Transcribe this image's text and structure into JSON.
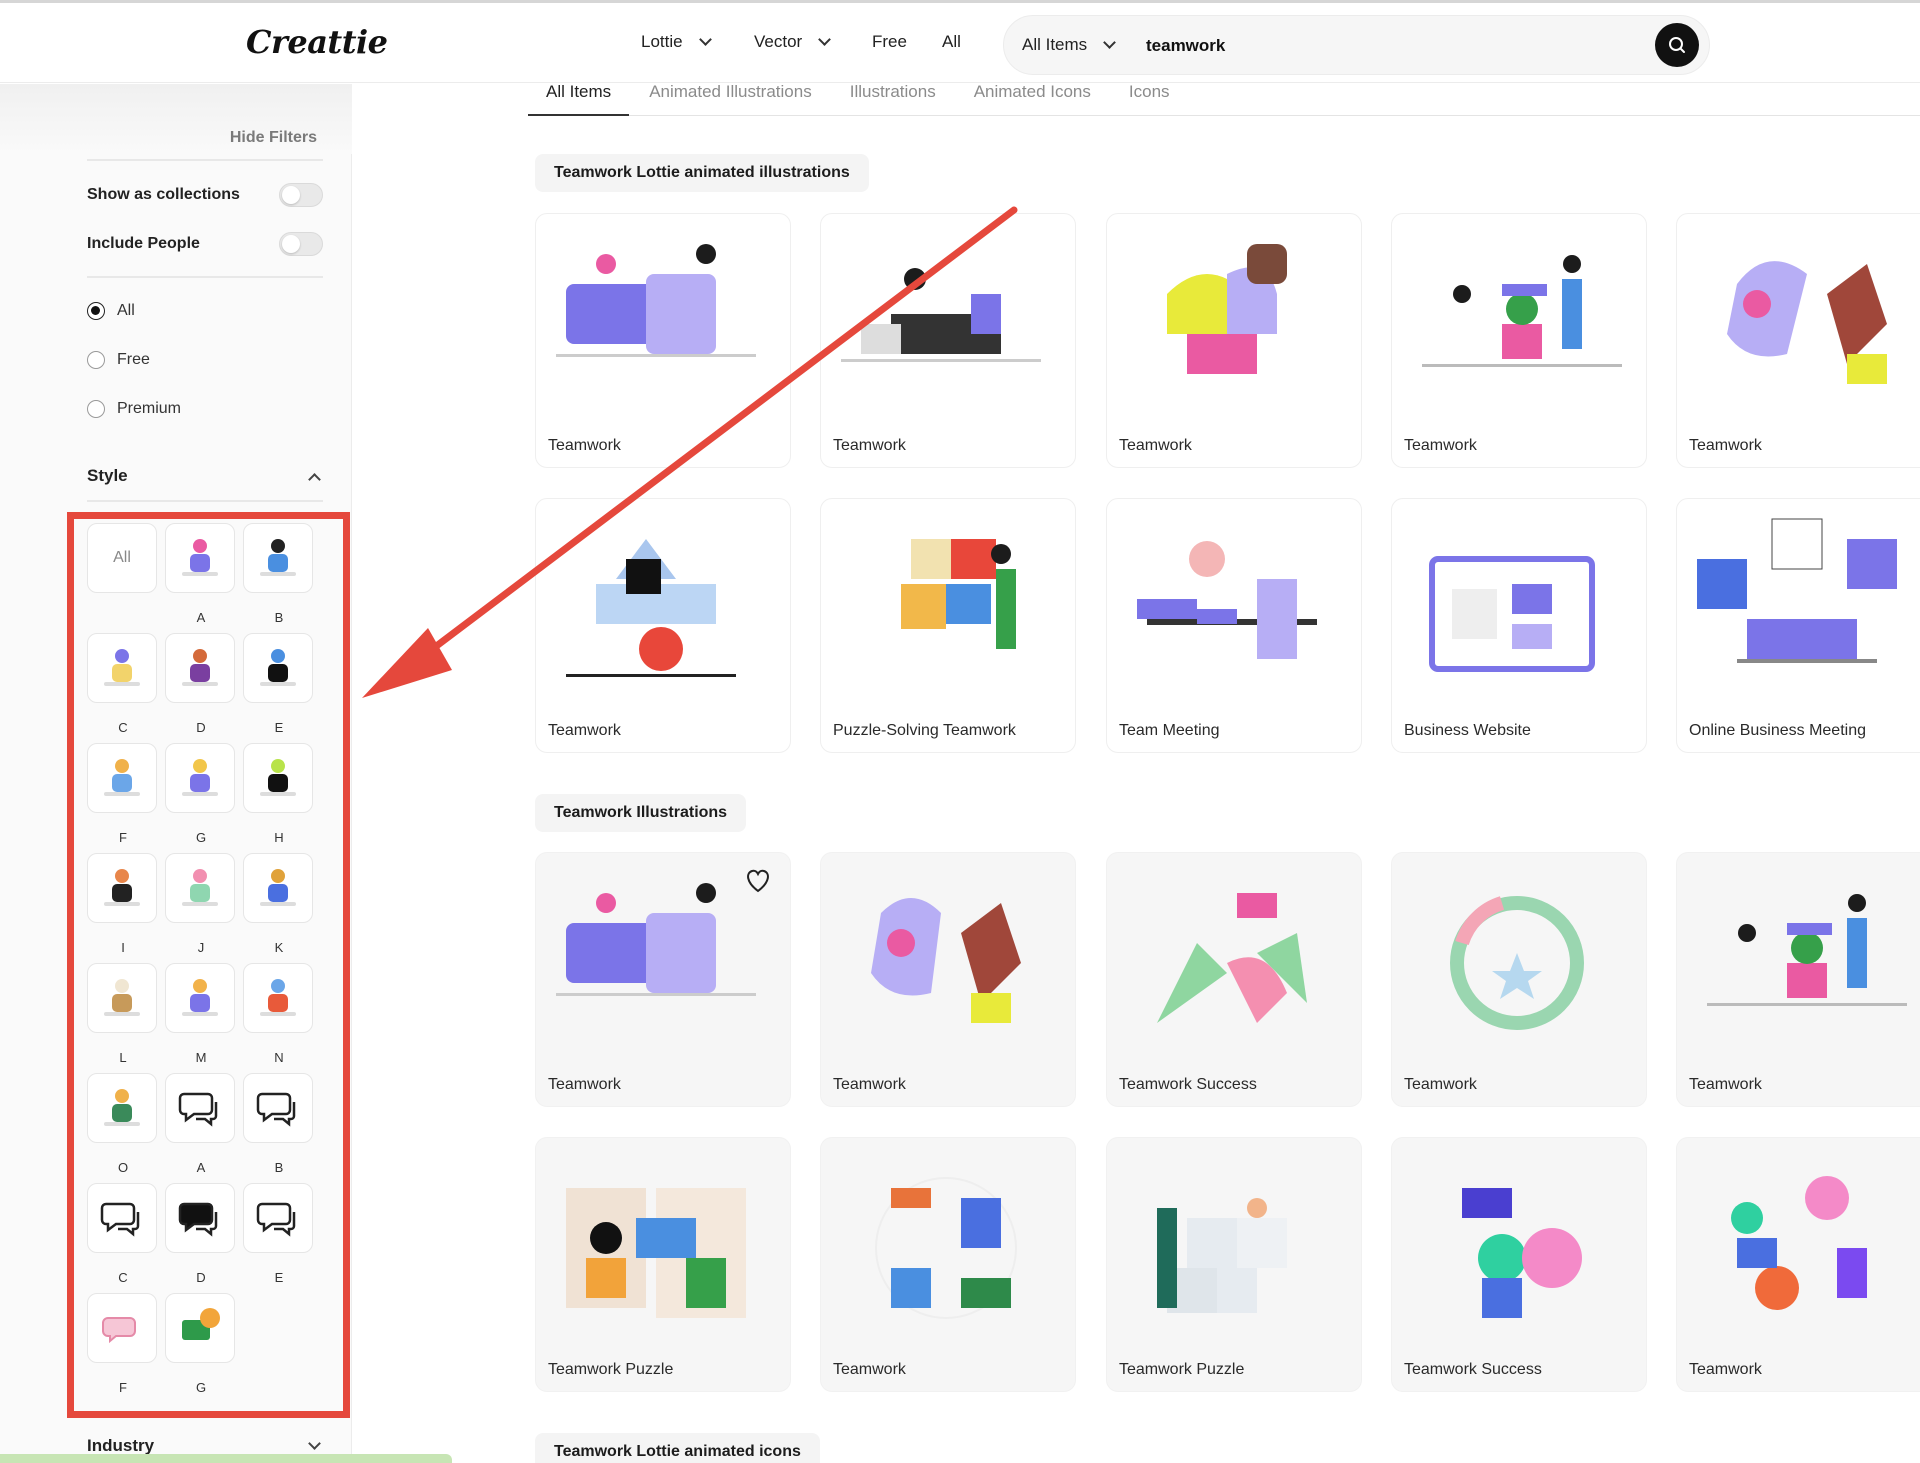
{
  "header": {
    "logo": "Creattie",
    "nav": [
      {
        "label": "Lottie",
        "has_dropdown": true
      },
      {
        "label": "Vector",
        "has_dropdown": true
      },
      {
        "label": "Free",
        "has_dropdown": false
      },
      {
        "label": "All",
        "has_dropdown": false
      }
    ],
    "search": {
      "type_label": "All Items",
      "query": "teamwork",
      "icon": "search-icon"
    }
  },
  "sidebar": {
    "hide_filters": "Hide Filters",
    "toggles": [
      {
        "label": "Show as collections",
        "on": false
      },
      {
        "label": "Include People",
        "on": false
      }
    ],
    "pricing": [
      {
        "label": "All",
        "selected": true
      },
      {
        "label": "Free",
        "selected": false
      },
      {
        "label": "Premium",
        "selected": false
      }
    ],
    "style": {
      "heading": "Style",
      "all_label": "All",
      "labels": [
        "A",
        "B",
        "C",
        "D",
        "E",
        "F",
        "G",
        "H",
        "I",
        "J",
        "K",
        "L",
        "M",
        "N",
        "O",
        "A",
        "B",
        "C",
        "D",
        "E",
        "F",
        "G"
      ]
    },
    "industry": "Industry"
  },
  "tabs": [
    "All Items",
    "Animated Illustrations",
    "Illustrations",
    "Animated Icons",
    "Icons"
  ],
  "sections": [
    {
      "title": "Teamwork Lottie animated illustrations",
      "cards": [
        "Teamwork",
        "Teamwork",
        "Teamwork",
        "Teamwork",
        "Teamwork",
        "Teamwork",
        "Puzzle-Solving Teamwork",
        "Team Meeting",
        "Business Website",
        "Online Business Meeting"
      ]
    },
    {
      "title": "Teamwork Illustrations",
      "cards": [
        "Teamwork",
        "Teamwork",
        "Teamwork Success",
        "Teamwork",
        "Teamwork",
        "Teamwork Puzzle",
        "Teamwork",
        "Teamwork Puzzle",
        "Teamwork Success",
        "Teamwork"
      ]
    },
    {
      "title": "Teamwork Lottie animated icons"
    }
  ],
  "colors": {
    "accent": "#e5483c",
    "purple": "#7b74e8",
    "lavender": "#b7aef5",
    "pink": "#ea5aa2",
    "yellow": "#e8ea3a",
    "green": "#36a04a",
    "dark": "#1c1c1c"
  }
}
